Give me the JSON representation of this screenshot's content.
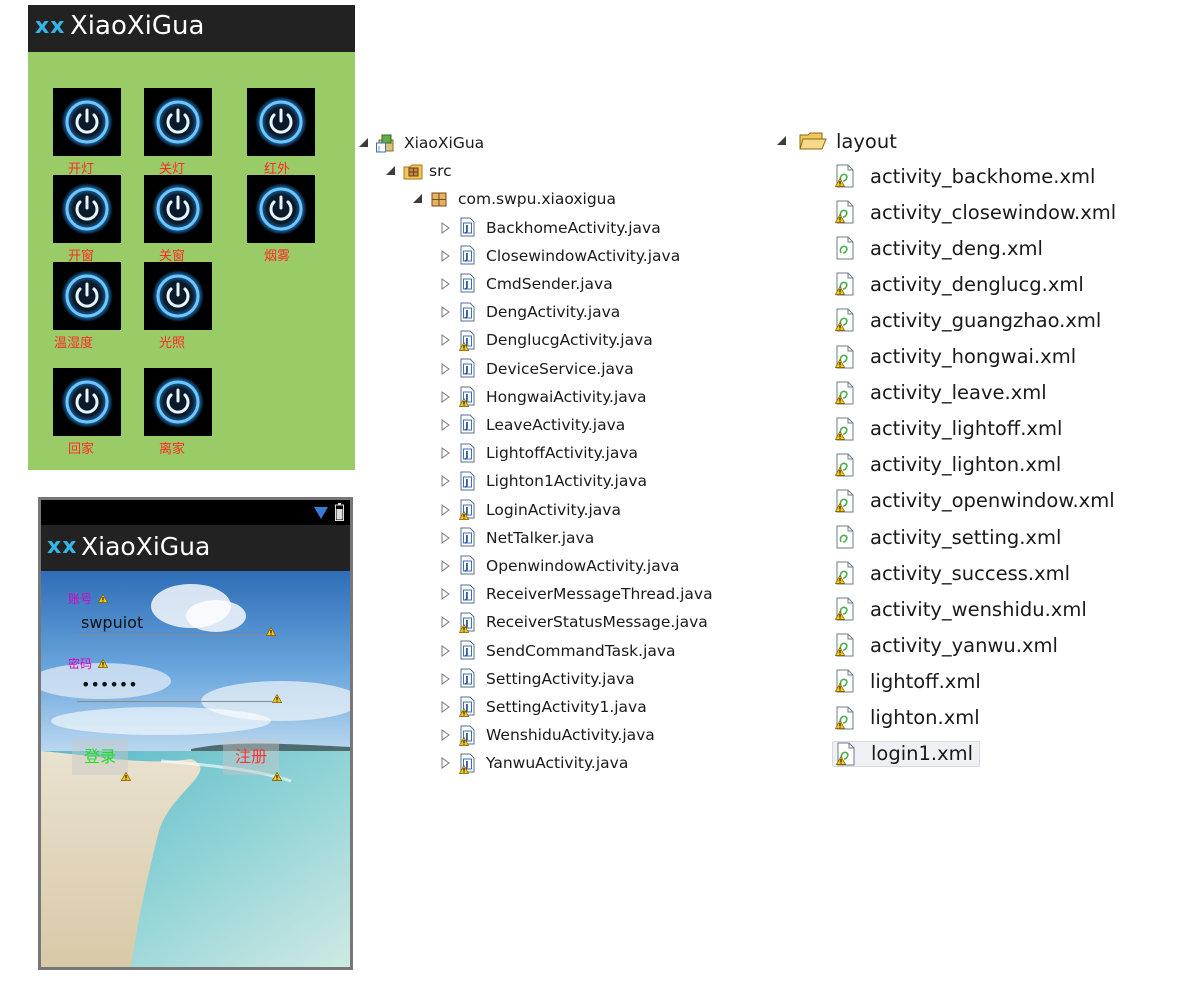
{
  "app": {
    "logo": "xx",
    "title": "XiaoXiGua"
  },
  "control_panel": {
    "buttons": [
      {
        "label": "开灯"
      },
      {
        "label": "关灯"
      },
      {
        "label": "红外"
      },
      {
        "label": "开窗"
      },
      {
        "label": "关窗"
      },
      {
        "label": "烟雾"
      },
      {
        "label": "温湿度"
      },
      {
        "label": "光照"
      },
      {
        "label": "回家"
      },
      {
        "label": "离家"
      }
    ]
  },
  "login": {
    "account_label": "账号",
    "account_value": "swpuiot",
    "password_label": "密码",
    "password_value": "••••••",
    "login_button": "登录",
    "register_button": "注册"
  },
  "project_tree": {
    "project": "XiaoXiGua",
    "src": "src",
    "package": "com.swpu.xiaoxigua",
    "files": [
      {
        "name": "BackhomeActivity.java",
        "warning": false
      },
      {
        "name": "ClosewindowActivity.java",
        "warning": false
      },
      {
        "name": "CmdSender.java",
        "warning": false
      },
      {
        "name": "DengActivity.java",
        "warning": false
      },
      {
        "name": "DenglucgActivity.java",
        "warning": true
      },
      {
        "name": "DeviceService.java",
        "warning": false
      },
      {
        "name": "HongwaiActivity.java",
        "warning": true
      },
      {
        "name": "LeaveActivity.java",
        "warning": false
      },
      {
        "name": "LightoffActivity.java",
        "warning": false
      },
      {
        "name": "Lighton1Activity.java",
        "warning": false
      },
      {
        "name": "LoginActivity.java",
        "warning": true
      },
      {
        "name": "NetTalker.java",
        "warning": false
      },
      {
        "name": "OpenwindowActivity.java",
        "warning": false
      },
      {
        "name": "ReceiverMessageThread.java",
        "warning": false
      },
      {
        "name": "ReceiverStatusMessage.java",
        "warning": true
      },
      {
        "name": "SendCommandTask.java",
        "warning": false
      },
      {
        "name": "SettingActivity.java",
        "warning": false
      },
      {
        "name": "SettingActivity1.java",
        "warning": true
      },
      {
        "name": "WenshiduActivity.java",
        "warning": true
      },
      {
        "name": "YanwuActivity.java",
        "warning": true
      }
    ]
  },
  "layout_tree": {
    "folder": "layout",
    "files": [
      {
        "name": "activity_backhome.xml",
        "warning": true
      },
      {
        "name": "activity_closewindow.xml",
        "warning": true
      },
      {
        "name": "activity_deng.xml",
        "warning": false
      },
      {
        "name": "activity_denglucg.xml",
        "warning": true
      },
      {
        "name": "activity_guangzhao.xml",
        "warning": true
      },
      {
        "name": "activity_hongwai.xml",
        "warning": true
      },
      {
        "name": "activity_leave.xml",
        "warning": true
      },
      {
        "name": "activity_lightoff.xml",
        "warning": true
      },
      {
        "name": "activity_lighton.xml",
        "warning": true
      },
      {
        "name": "activity_openwindow.xml",
        "warning": true
      },
      {
        "name": "activity_setting.xml",
        "warning": false
      },
      {
        "name": "activity_success.xml",
        "warning": true
      },
      {
        "name": "activity_wenshidu.xml",
        "warning": true
      },
      {
        "name": "activity_yanwu.xml",
        "warning": true
      },
      {
        "name": "lightoff.xml",
        "warning": true
      },
      {
        "name": "lighton.xml",
        "warning": true
      },
      {
        "name": "login1.xml",
        "warning": true
      }
    ],
    "selected": "login1.xml"
  },
  "colors": {
    "panel_green": "#99cc66",
    "action_bar": "#222222",
    "holo_blue": "#35b5e5",
    "button_label_red": "#ff2a2a",
    "login_label_magenta": "#e000c0",
    "login_green": "#22dd22",
    "register_red": "#ff3333",
    "warning_yellow": "#f5c518"
  }
}
